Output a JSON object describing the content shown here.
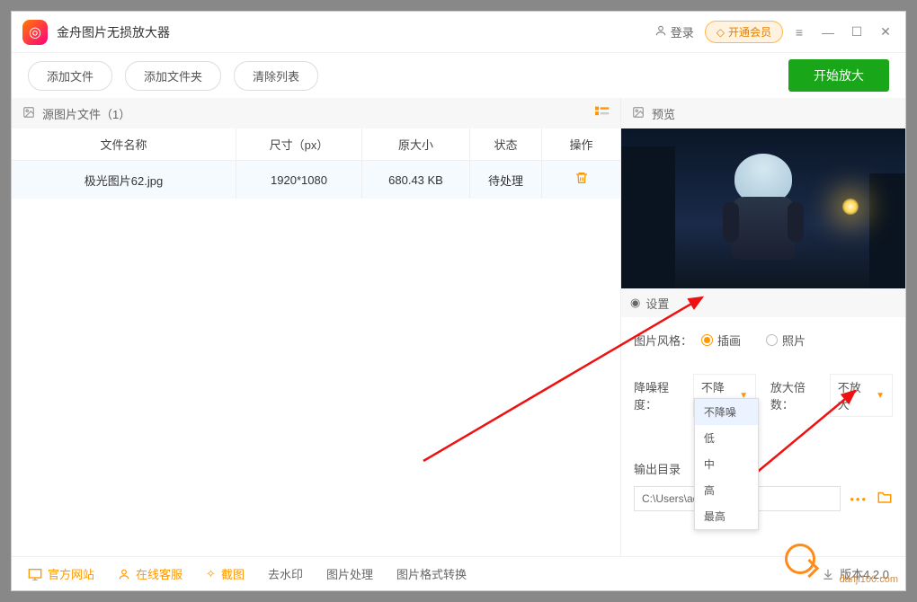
{
  "app": {
    "title": "金舟图片无损放大器"
  },
  "titlebar": {
    "login": "登录",
    "vip": "开通会员"
  },
  "toolbar": {
    "add_file": "添加文件",
    "add_folder": "添加文件夹",
    "clear": "清除列表",
    "start": "开始放大"
  },
  "source_panel": {
    "title": "源图片文件（1）"
  },
  "table": {
    "headers": {
      "name": "文件名称",
      "size": "尺寸（px）",
      "orig": "原大小",
      "status": "状态",
      "action": "操作"
    },
    "rows": [
      {
        "name": "极光图片62.jpg",
        "size": "1920*1080",
        "orig": "680.43 KB",
        "status": "待处理"
      }
    ]
  },
  "preview": {
    "title": "预览"
  },
  "settings": {
    "title": "设置",
    "style_label": "图片风格：",
    "style_options": {
      "illustration": "插画",
      "photo": "照片"
    },
    "noise_label": "降噪程度：",
    "noise_value": "不降噪",
    "noise_options": [
      "不降噪",
      "低",
      "中",
      "高",
      "最高"
    ],
    "scale_label": "放大倍数：",
    "scale_value": "不放大",
    "output_label": "输出目录",
    "output_path": "C:\\Users\\ad            ads"
  },
  "statusbar": {
    "website": "官方网站",
    "support": "在线客服",
    "screenshot": "截图",
    "watermark": "去水印",
    "process": "图片处理",
    "convert": "图片格式转换",
    "version": "版本4.2.0"
  },
  "watermark": "danji100.com"
}
